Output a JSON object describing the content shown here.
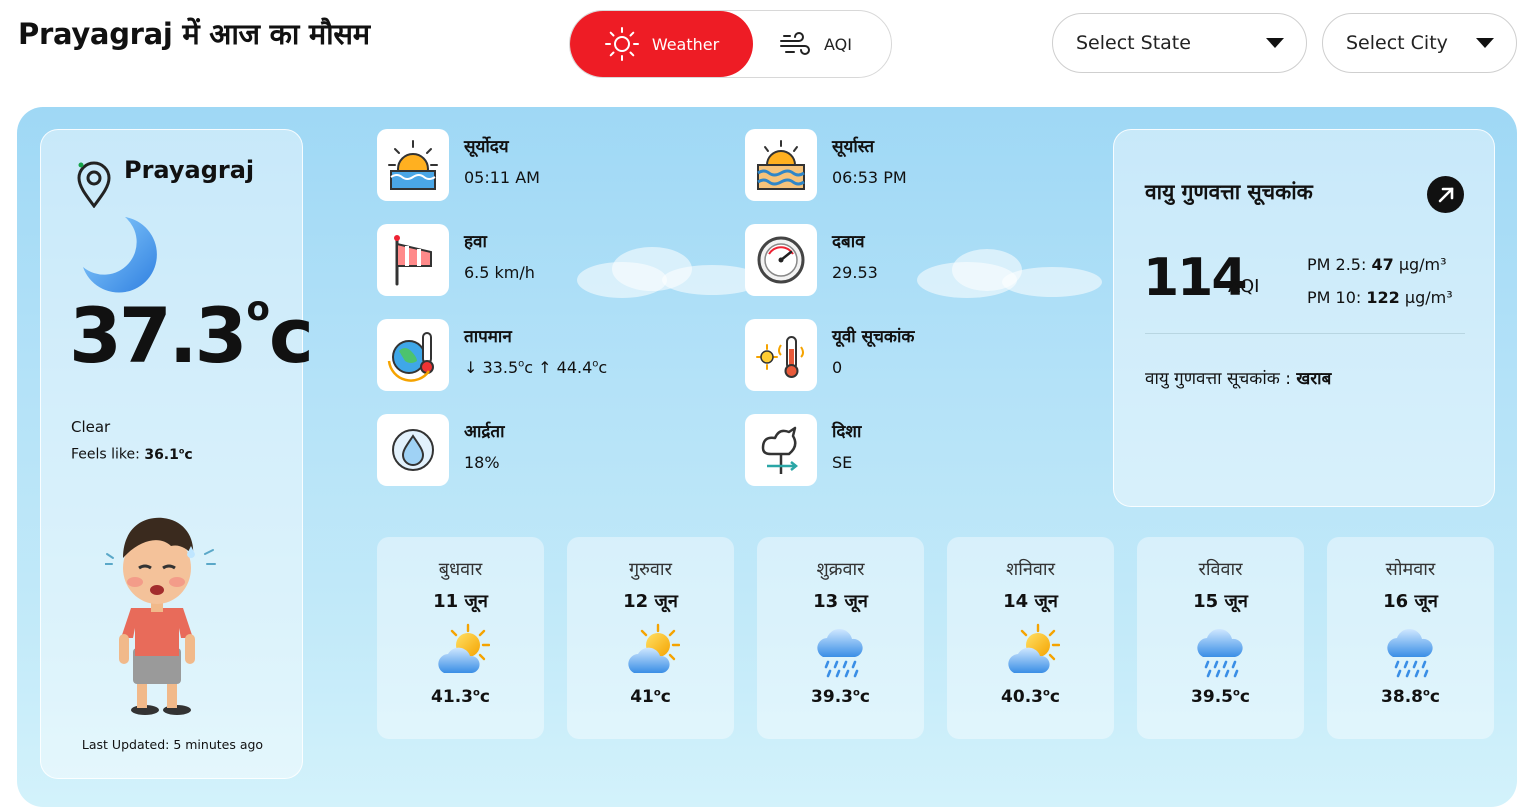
{
  "page_title": "Prayagraj में आज का मौसम",
  "toggle": {
    "weather_label": "Weather",
    "aqi_label": "AQI"
  },
  "selects": {
    "state": "Select State",
    "city": "Select City"
  },
  "location": {
    "name": "Prayagraj",
    "temp_value": "37.3",
    "temp_unit": "c",
    "condition": "Clear",
    "feels_label": "Feels like:",
    "feels_value": "36.1",
    "feels_unit": "c",
    "last_updated": "Last Updated: 5 minutes ago"
  },
  "metrics": {
    "sunrise": {
      "label": "सूर्योदय",
      "value": "05:11 AM"
    },
    "sunset": {
      "label": "सूर्यास्त",
      "value": "06:53 PM"
    },
    "wind": {
      "label": "हवा",
      "value": "6.5 km/h"
    },
    "pressure": {
      "label": "दबाव",
      "value": "29.53"
    },
    "temperature": {
      "label": "तापमान",
      "min_arrow": "↓",
      "min": "33.5",
      "max_arrow": "↑",
      "max": "44.4",
      "unit": "c",
      "degree": "o"
    },
    "uv": {
      "label": "यूवी सूचकांक",
      "value": "0"
    },
    "humidity": {
      "label": "आर्द्रता",
      "value": "18%"
    },
    "direction": {
      "label": "दिशा",
      "value": "SE"
    }
  },
  "aqi": {
    "title": "वायु गुणवत्ता सूचकांक",
    "value": "114",
    "unit": "AQI",
    "pm25_label": "PM 2.5:",
    "pm25_value": "47",
    "pm25_unit": "µg/m³",
    "pm10_label": "PM 10:",
    "pm10_value": "122",
    "pm10_unit": "µg/m³",
    "status_label": "वायु गुणवत्ता सूचकांक :",
    "status_value": "खराब"
  },
  "forecast": [
    {
      "day": "बुधवार",
      "date": "11 जून",
      "temp": "41.3",
      "unit": "c",
      "icon": "partly-sunny-icon"
    },
    {
      "day": "गुरुवार",
      "date": "12 जून",
      "temp": "41",
      "unit": "c",
      "icon": "partly-sunny-icon"
    },
    {
      "day": "शुक्रवार",
      "date": "13 जून",
      "temp": "39.3",
      "unit": "c",
      "icon": "rain-cloud-icon"
    },
    {
      "day": "शनिवार",
      "date": "14 जून",
      "temp": "40.3",
      "unit": "c",
      "icon": "partly-sunny-icon"
    },
    {
      "day": "रविवार",
      "date": "15 जून",
      "temp": "39.5",
      "unit": "c",
      "icon": "rain-cloud-icon"
    },
    {
      "day": "सोमवार",
      "date": "16 जून",
      "temp": "38.8",
      "unit": "c",
      "icon": "rain-cloud-icon"
    }
  ],
  "colors": {
    "accent": "#ee1c25",
    "sky_top": "#9fd8f5",
    "sky_bottom": "#d3f2fb"
  }
}
